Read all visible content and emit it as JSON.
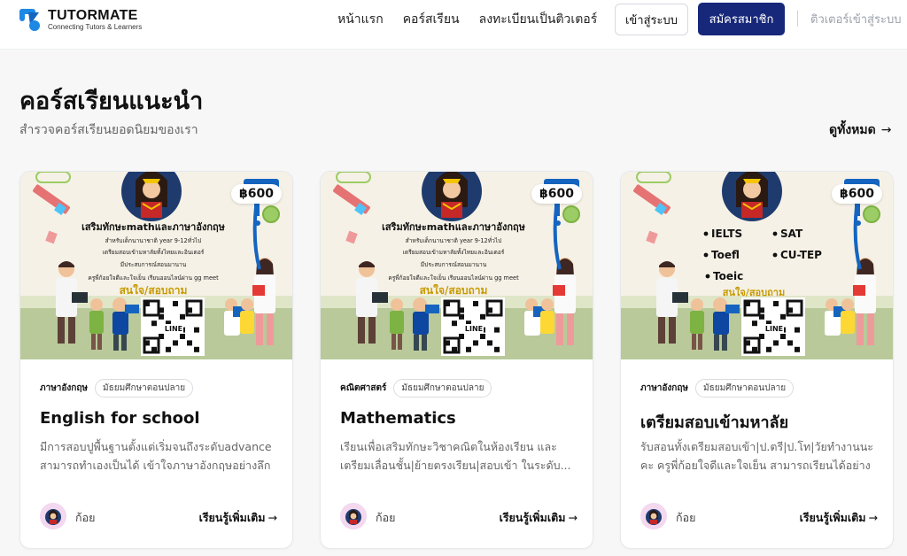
{
  "brand": {
    "name": "TUTORMATE",
    "tagline": "Connecting Tutors & Learners",
    "colors": {
      "primary": "#17287a",
      "accent": "#1e88e5"
    }
  },
  "nav": {
    "links": [
      "หน้าแรก",
      "คอร์สเรียน",
      "ลงทะเบียนเป็นติวเตอร์"
    ],
    "login_label": "เข้าสู่ระบบ",
    "signup_label": "สมัครสมาชิก",
    "tutor_login_label": "ติวเตอร์เข้าสู่ระบบ"
  },
  "section": {
    "title": "คอร์สเรียนแนะนำ",
    "subtitle": "สำรวจคอร์สเรียนยอดนิยมของเรา",
    "see_all_label": "ดูทั้งหมด"
  },
  "courses": [
    {
      "price": "฿600",
      "subject": "ภาษาอังกฤษ",
      "level": "มัธยมศึกษาตอนปลาย",
      "title": "English for school",
      "description": "มีการสอบปูพื้นฐานตั้งแต่เริ่มจนถึงระดับadvance สามารถทำเองเป็นได้ เข้าใจภาษาอังกฤษอย่างลึกซึ้...",
      "tutor": "ก้อย",
      "cta": "เรียนรู้เพิ่มเติม",
      "poster": {
        "headline": "เสริมทักษะmathและภาษาอังกฤษ",
        "lines": [
          "สำหรับเด็กนานาชาติ year 9-12ทั่วไป",
          "เตรียมสอบเข้ามหาลัยทั้งไทยและอินเตอร์",
          "มีประสบการณ์สอนมานาน",
          "ครูพี่ก้อยใจดีและใจเย็น เรียนออนไลน์ผ่าน gg meet"
        ],
        "cta": "สนใจ/สอบถาม",
        "qr_label": "LINE"
      }
    },
    {
      "price": "฿600",
      "subject": "คณิตศาสตร์",
      "level": "มัธยมศึกษาตอนปลาย",
      "title": "Mathematics",
      "description": "เรียนเพื่อเสริมทักษะวิชาคณิตในห้องเรียน และ เตรียมเลื่อนชั้น|ย้ายตรงเรียน|สอบเข้า ในระดับ...",
      "tutor": "ก้อย",
      "cta": "เรียนรู้เพิ่มเติม",
      "poster": {
        "headline": "เสริมทักษะmathและภาษาอังกฤษ",
        "lines": [
          "สำหรับเด็กนานาชาติ year 9-12ทั่วไป",
          "เตรียมสอบเข้ามหาลัยทั้งไทยและอินเตอร์",
          "มีประสบการณ์สอนมานาน",
          "ครูพี่ก้อยใจดีและใจเย็น เรียนออนไลน์ผ่าน gg meet"
        ],
        "cta": "สนใจ/สอบถาม",
        "qr_label": "LINE"
      }
    },
    {
      "price": "฿600",
      "subject": "ภาษาอังกฤษ",
      "level": "มัธยมศึกษาตอนปลาย",
      "title": "เตรียมสอบเข้ามหาลัย",
      "description": "รับสอนทั้งเตรียมสอบเข้า|ป.ตรี|ป.โท|วัยทำงานนะ คะ ครูพี่ก้อยใจดีและใจเย็น สามารถเรียนได้อย่างไ...",
      "tutor": "ก้อย",
      "cta": "เรียนรู้เพิ่มเติม",
      "poster": {
        "exams": [
          "IELTS",
          "SAT",
          "Toefl",
          "CU-TEP",
          "Toeic"
        ],
        "cta": "สนใจ/สอบถาม",
        "qr_label": "LINE"
      }
    }
  ]
}
